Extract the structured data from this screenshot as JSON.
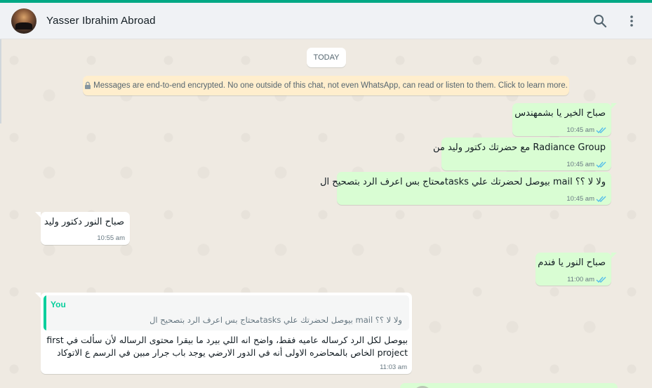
{
  "header": {
    "contact_name": "Yasser Ibrahim Abroad",
    "icons": [
      "search-icon",
      "menu-icon"
    ]
  },
  "chat": {
    "date_label": "TODAY",
    "encryption_notice": "Messages are end-to-end encrypted. No one outside of this chat, not even WhatsApp, can read or listen to them. Click to learn more.",
    "messages": [
      {
        "direction": "out",
        "text": "صباح الخير يا بشمهندس",
        "time": "10:45 am",
        "status": "read"
      },
      {
        "direction": "out",
        "text": "مع حضرتك دكتور وليد من Radiance Group",
        "time": "10:45 am",
        "status": "read"
      },
      {
        "direction": "out",
        "text": "محتاج بس اعرف الرد بتصحيح الtasks بيوصل لحضرتك علي mail ولا لا ؟؟",
        "time": "10:45 am",
        "status": "read"
      },
      {
        "direction": "in",
        "text": "صباح النور دكتور وليد",
        "time": "10:55 am"
      },
      {
        "direction": "out",
        "text": "صباح النور يا فندم",
        "time": "11:00 am",
        "status": "read"
      },
      {
        "direction": "in",
        "quote_author": "You",
        "quote_text": "محتاج بس اعرف الرد بتصحيح الtasks بيوصل لحضرتك علي mail ولا لا ؟؟",
        "lines": [
          "بيوصل لكل الرد كرساله عاميه فقط، واضح انه اللي بيرد ما بيقرا محتوى الرساله لأن سألت في first",
          "project الخاص بالمحاضره الاولى أنه في الدور الارضي يوجد باب جرار مبين في الرسم ع الاتوكاد"
        ],
        "time": "11:03 am"
      }
    ]
  },
  "colors": {
    "accent": "#00a884",
    "outgoing_bubble": "#d9fdd3",
    "incoming_bubble": "#ffffff",
    "read_ticks": "#53bdeb",
    "chat_background": "#efeae2",
    "encryption_banner": "#ffeecd"
  }
}
